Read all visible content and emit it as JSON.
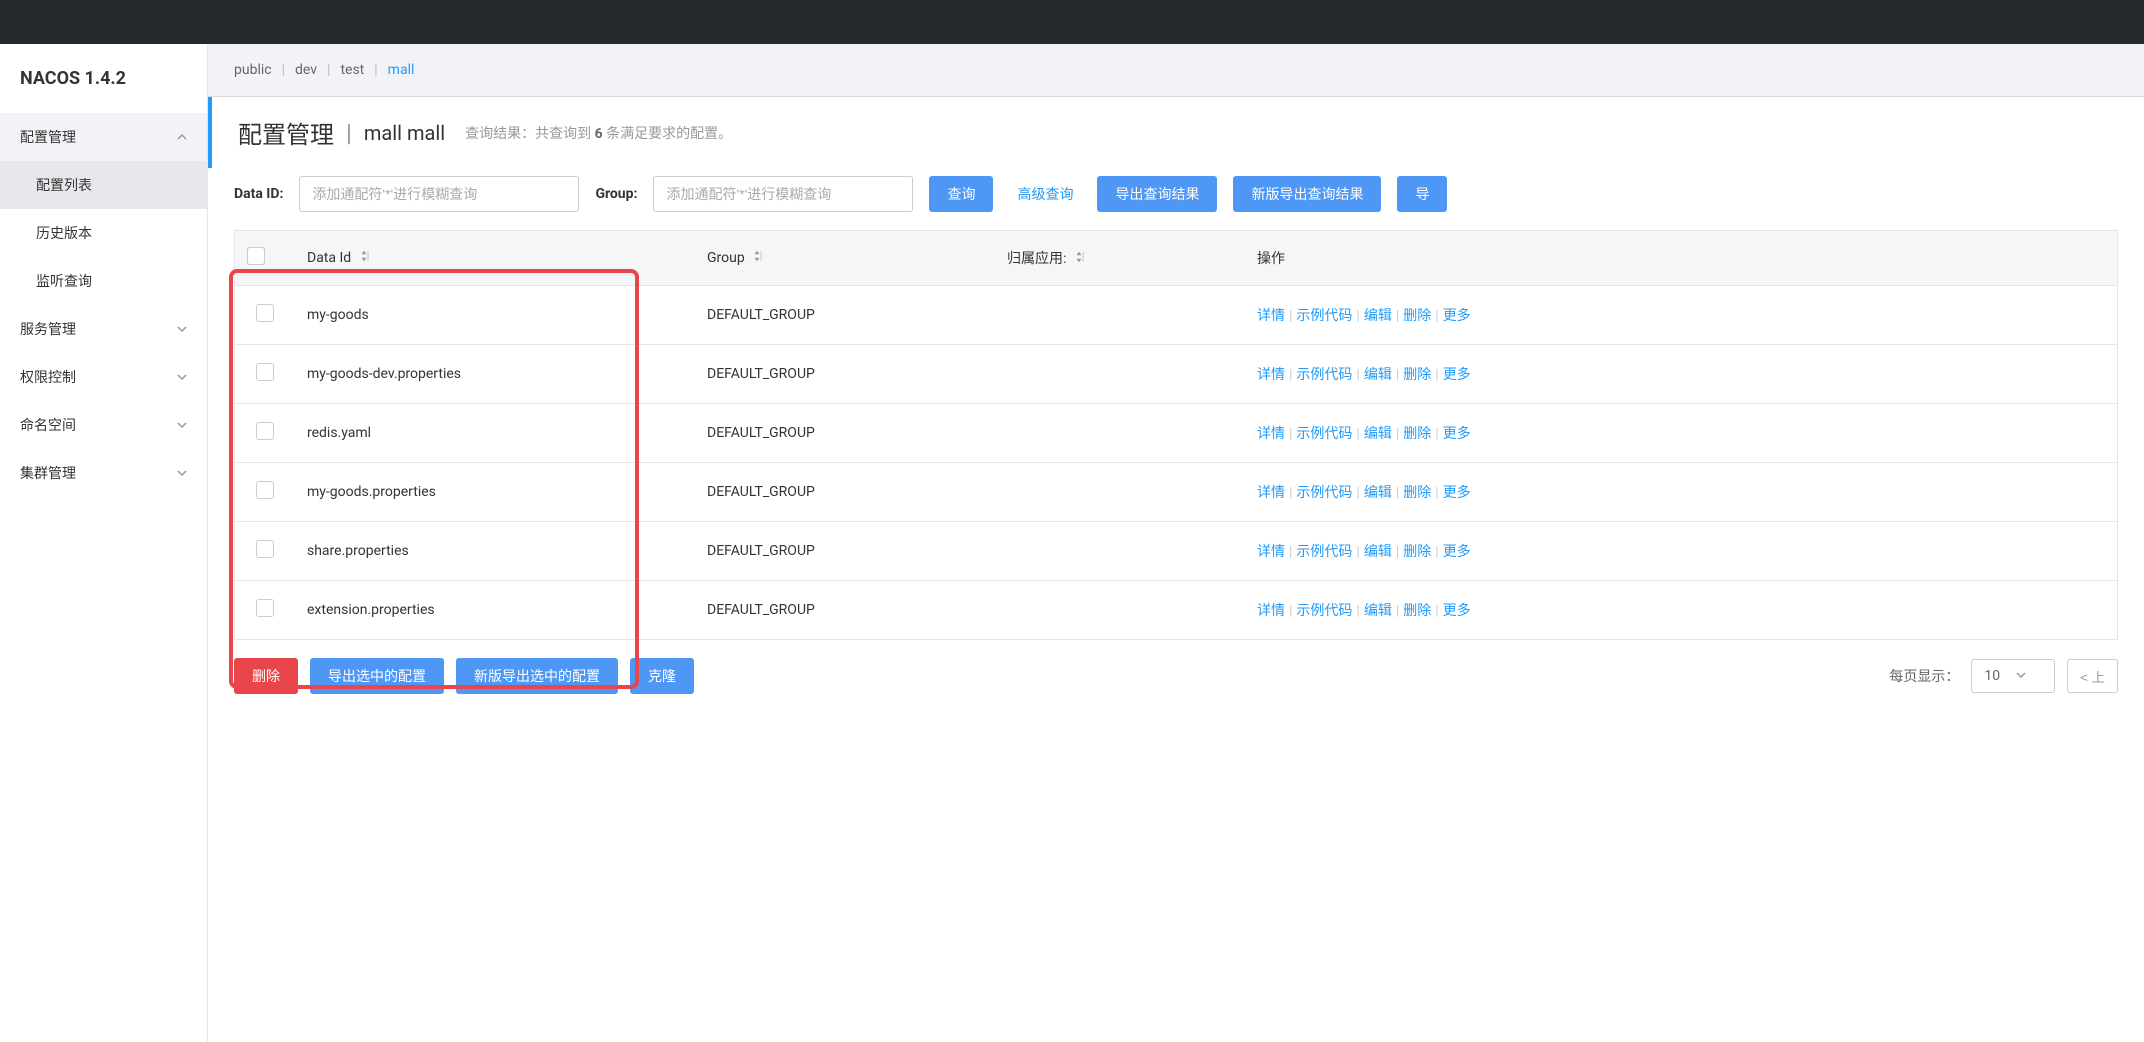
{
  "logo": "NACOS 1.4.2",
  "sidebar": {
    "groups": [
      {
        "title": "配置管理",
        "expanded": true,
        "items": [
          {
            "label": "配置列表",
            "active": true
          },
          {
            "label": "历史版本",
            "active": false
          },
          {
            "label": "监听查询",
            "active": false
          }
        ]
      },
      {
        "title": "服务管理",
        "expanded": false,
        "items": []
      },
      {
        "title": "权限控制",
        "expanded": false,
        "items": []
      },
      {
        "title": "命名空间",
        "expanded": false,
        "items": []
      },
      {
        "title": "集群管理",
        "expanded": false,
        "items": []
      }
    ]
  },
  "namespaces": [
    {
      "label": "public",
      "active": false
    },
    {
      "label": "dev",
      "active": false
    },
    {
      "label": "test",
      "active": false
    },
    {
      "label": "mall",
      "active": true
    }
  ],
  "header": {
    "title": "配置管理",
    "ns_name": "mall",
    "ns_id": "mall",
    "result_prefix": "查询结果：共查询到 ",
    "result_count": "6",
    "result_suffix": " 条满足要求的配置。"
  },
  "search": {
    "dataid_label": "Data ID:",
    "dataid_placeholder": "添加通配符'*'进行模糊查询",
    "group_label": "Group:",
    "group_placeholder": "添加通配符'*'进行模糊查询",
    "query_btn": "查询",
    "advanced_btn": "高级查询",
    "export_btn": "导出查询结果",
    "export_new_btn": "新版导出查询结果",
    "import_btn": "导"
  },
  "table": {
    "headers": {
      "dataid": "Data Id",
      "group": "Group",
      "app": "归属应用:",
      "action": "操作"
    },
    "rows": [
      {
        "dataid": "my-goods",
        "group": "DEFAULT_GROUP",
        "app": ""
      },
      {
        "dataid": "my-goods-dev.properties",
        "group": "DEFAULT_GROUP",
        "app": ""
      },
      {
        "dataid": "redis.yaml",
        "group": "DEFAULT_GROUP",
        "app": ""
      },
      {
        "dataid": "my-goods.properties",
        "group": "DEFAULT_GROUP",
        "app": ""
      },
      {
        "dataid": "share.properties",
        "group": "DEFAULT_GROUP",
        "app": ""
      },
      {
        "dataid": "extension.properties",
        "group": "DEFAULT_GROUP",
        "app": ""
      }
    ],
    "actions": {
      "detail": "详情",
      "example": "示例代码",
      "edit": "编辑",
      "delete": "删除",
      "more": "更多"
    }
  },
  "footer": {
    "delete_btn": "删除",
    "export_sel_btn": "导出选中的配置",
    "export_sel_new_btn": "新版导出选中的配置",
    "clone_btn": "克隆",
    "page_size_label": "每页显示：",
    "page_size_value": "10",
    "prev_label": "< 上"
  }
}
